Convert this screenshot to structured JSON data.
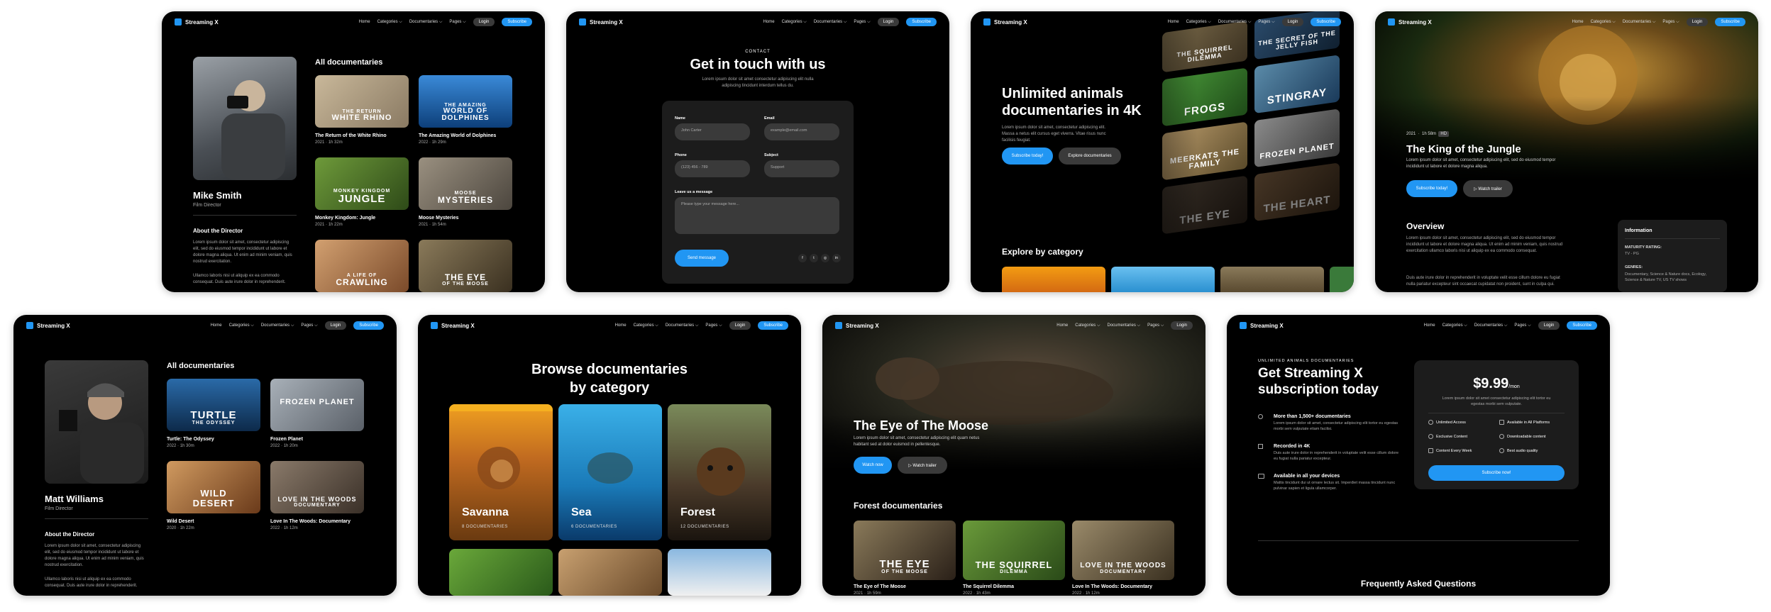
{
  "brand": "Streaming X",
  "nav": {
    "home": "Home",
    "categories": "Categories ⌵",
    "documentaries": "Documentaries ⌵",
    "pages": "Pages ⌵",
    "login": "Login",
    "subscribe": "Subscribe"
  },
  "c1": {
    "name": "Mike Smith",
    "role": "Film Director",
    "section": "All documentaries",
    "about": "About the Director",
    "bio1": "Lorem ipsum dolor sit amet, consectetur adipiscing elit, sed do eiusmod tempor incididunt ut labore et dolore magna aliqua. Ut enim ad minim veniam, quis nostrud exercitation.",
    "bio2": "Ullamco laboris nisi ut aliquip ex ea commodo consequat. Duis aute irure dolor in reprehenderit.",
    "films": [
      {
        "t1": "THE RETURN",
        "t2": "WHITE RHINO",
        "title": "The Return of the White Rhino",
        "year": "2021",
        "dur": "1h 32m"
      },
      {
        "t1": "THE AMAZING",
        "t2": "WORLD OF DOLPHINES",
        "title": "The Amazing World of Dolphines",
        "year": "2022",
        "dur": "1h 29m"
      },
      {
        "t1": "MONKEY KINGDOM",
        "t2": "JUNGLE",
        "title": "Monkey Kingdom: Jungle",
        "year": "2021",
        "dur": "1h 22m"
      },
      {
        "t1": "MOOSE",
        "t2": "MYSTERIES",
        "title": "Moose Mysteries",
        "year": "2021",
        "dur": "1h 54m"
      },
      {
        "t1": "A LIFE OF",
        "t2": "CRAWLING",
        "title": "",
        "year": "",
        "dur": ""
      },
      {
        "t1": "THE EYE",
        "t2": "OF THE MOOSE",
        "title": "",
        "year": "",
        "dur": ""
      }
    ]
  },
  "c2": {
    "eyebrow": "CONTACT",
    "title": "Get in touch with us",
    "sub": "Lorem ipsum dolor sit amet consectetur adipiscing elit nulla adipiscing tincidunt interdum tellus du.",
    "name_l": "Name",
    "name_v": "John Carter",
    "email_l": "Email",
    "email_v": "example@email.com",
    "phone_l": "Phone",
    "phone_v": "(123) 456 - 789",
    "subject_l": "Subject",
    "subject_v": "Support",
    "msg_l": "Leave us a message",
    "msg_v": "Please type your message here...",
    "send": "Send message",
    "social": [
      "f",
      "t",
      "◎",
      "in"
    ]
  },
  "c3": {
    "title": "Unlimited animals documentaries in 4K",
    "sub": "Lorem ipsum dolor sit amet, consectetur adipiscing elit. Massa a netus elit cursus eget viverra. Vitae risus nunc facilisis feugiat.",
    "b1": "Subscribe today!",
    "b2": "Explore documentaries",
    "explore": "Explore by category",
    "posters": [
      "THE SQUIRREL DILEMMA",
      "THE SECRET OF THE JELLY FISH",
      "FROGS",
      "STINGRAY",
      "MEERKATS THE FAMILY",
      "FROZEN PLANET",
      "THE EYE",
      "THE HEART"
    ]
  },
  "c4": {
    "year": "2021",
    "dur": "1h 58m",
    "rating": "HD",
    "title": "The King of the Jungle",
    "desc": "Lorem ipsum dolor sit amet, consectetur adipiscing elit, sed do eiusmod tempor incididunt ut labore et dolore magna aliqua.",
    "b1": "Subscribe today!",
    "b2": "▷ Watch trailer",
    "overview": "Overview",
    "ov1": "Lorem ipsum dolor sit amet, consectetur adipiscing elit, sed do eiusmod tempor incididunt ut labore et dolore magna aliqua. Ut enim ad minim veniam, quis nostrud exercitation ullamco laboris nisi ut aliquip ex ea commodo consequat.",
    "ov2": "Duis aute irure dolor in reprehenderit in voluptate velit esse cillum dolore eu fugiat nulla pariatur excepteur sint occaecat cupidatat non proident, sunt in culpa qui.",
    "info": "Information",
    "mr_l": "MATURITY RATING:",
    "mr_v": "TV - PG",
    "genres_l": "GENRES:",
    "genres_v": "Documentary, Science & Nature docs, Ecology, Science & Nature TV, US TV shows"
  },
  "c5": {
    "name": "Matt Williams",
    "role": "Film Director",
    "section": "All documentaries",
    "about": "About the Director",
    "bio1": "Lorem ipsum dolor sit amet, consectetur adipiscing elit, sed do eiusmod tempor incididunt ut labore et dolore magna aliqua. Ut enim ad minim veniam, quis nostrud exercitation.",
    "bio2": "Ullamco laboris nisi ut aliquip ex ea commodo consequat. Duis aute irure dolor in reprehenderit.",
    "films": [
      {
        "t1": "TURTLE",
        "t2": "THE ODYSSEY",
        "title": "Turtle: The Odyssey",
        "year": "2022",
        "dur": "1h 30m"
      },
      {
        "t1": "",
        "t2": "FROZEN PLANET",
        "title": "Frozen Planet",
        "year": "2022",
        "dur": "1h 20m"
      },
      {
        "t1": "WILD",
        "t2": "DESERT",
        "title": "Wild Desert",
        "year": "2020",
        "dur": "1h 22m"
      },
      {
        "t1": "LOVE IN THE WOODS",
        "t2": "DOCUMENTARY",
        "title": "Love In The Woods: Documentary",
        "year": "2022",
        "dur": "1h 12m"
      }
    ]
  },
  "c6": {
    "title1": "Browse documentaries",
    "title2": "by category",
    "cats": [
      {
        "name": "Savanna",
        "count": "8 DOCUMENTARIES"
      },
      {
        "name": "Sea",
        "count": "6 DOCUMENTARIES"
      },
      {
        "name": "Forest",
        "count": "12 DOCUMENTARIES"
      }
    ]
  },
  "c7": {
    "title": "The Eye of The Moose",
    "desc": "Lorem ipsum dolor sit amet, consectetur adipiscing elit quam netus habitant sed at dolor euismod in pellentesque.",
    "b1": "Watch now",
    "b2": "▷ Watch trailer",
    "section": "Forest documentaries",
    "films": [
      {
        "t1": "THE EYE",
        "t2": "OF THE MOOSE",
        "title": "The Eye of The Moose",
        "year": "2021",
        "dur": "1h 59m"
      },
      {
        "t1": "THE SQUIRREL",
        "t2": "DILEMMA",
        "title": "The Squirrel Dilemma",
        "year": "2022",
        "dur": "1h 43m"
      },
      {
        "t1": "LOVE IN THE WOODS",
        "t2": "DOCUMENTARY",
        "title": "Love In The Woods: Documentary",
        "year": "2022",
        "dur": "1h 12m"
      }
    ]
  },
  "c8": {
    "eyebrow": "UNLIMITED ANIMALS DOCUMENTARIES",
    "title": "Get Streaming X subscription today",
    "f1_t": "More than 1,500+ documentaries",
    "f1_d": "Lorem ipsum dolor sit amet, consectetur adipiscing elit tortor eu egestas morbi sem vulputate etiam facilisi.",
    "f2_t": "Recorded in 4K",
    "f2_d": "Duis aute irure dolor in reprehenderit in voluptate velit esse cillum dolore eu fugiat nulla pariatur excepteur.",
    "f3_t": "Available in all your devices",
    "f3_d": "Mattis tincidunt dui ut ornare lectus sit. Imperdiet massa tincidunt nunc pulvinar sapien et ligula ullamcorper.",
    "price": "$9.99",
    "per": "/mon",
    "price_d": "Lorem ipsum dolor sit amet consectetur adipiscing elit tortor eu egestas morbi sem vulputate.",
    "p1": "Unlimited Access",
    "p2": "Available in All Platforms",
    "p3": "Exclusive Content",
    "p4": "Downloadable content",
    "p5": "Content Every Week",
    "p6": "Best audio quality",
    "cta": "Subscribe now!",
    "faq": "Frequently Asked Questions"
  }
}
